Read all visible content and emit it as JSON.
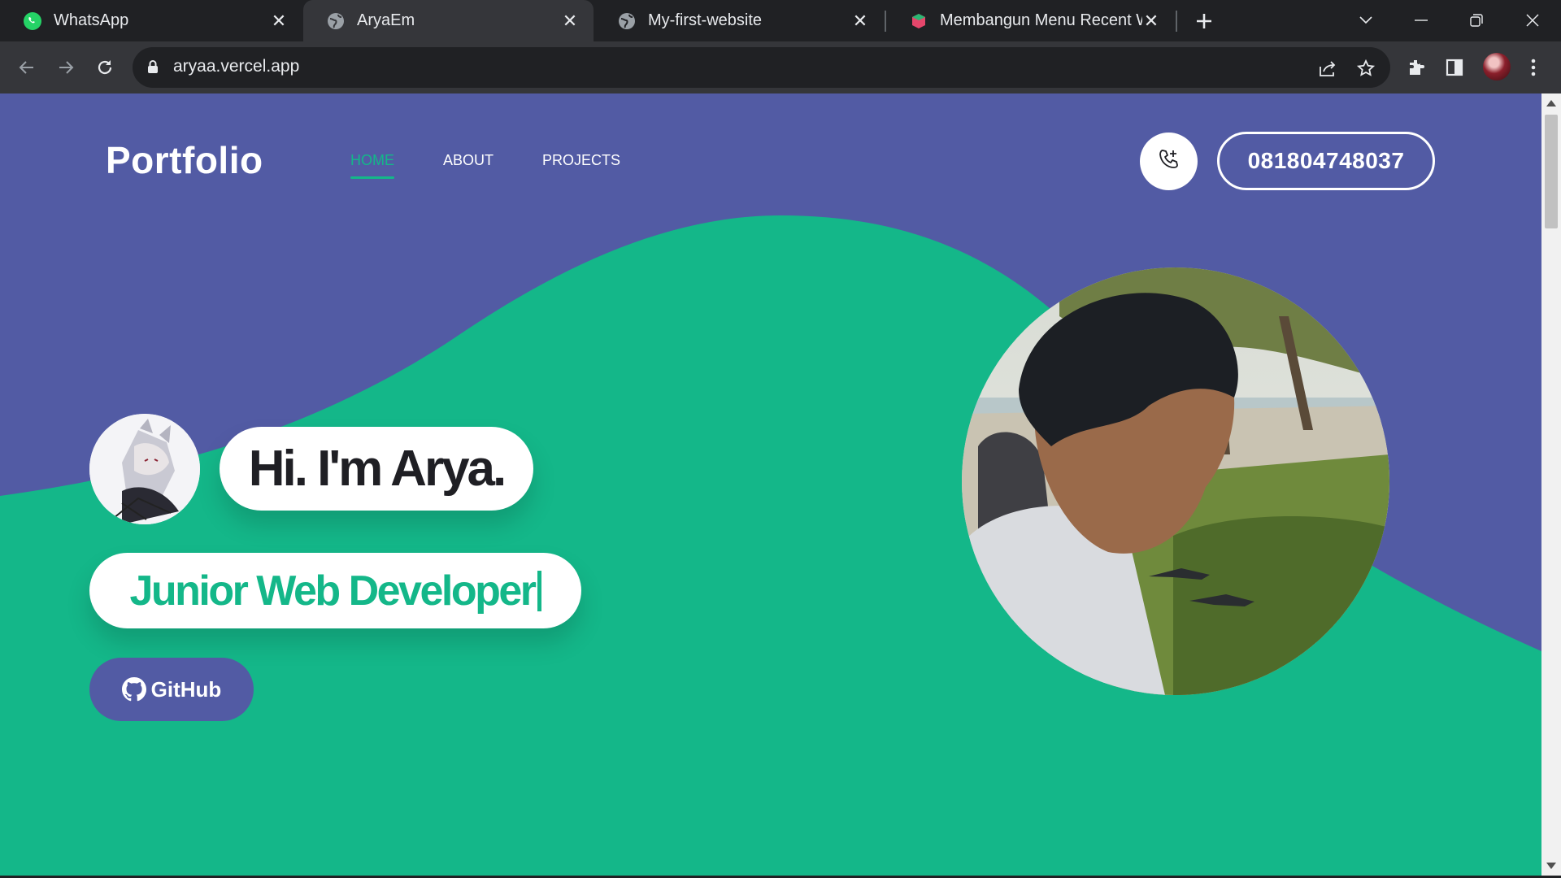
{
  "browser": {
    "tabs": [
      {
        "title": "WhatsApp",
        "icon": "whatsapp-icon",
        "active": false
      },
      {
        "title": "AryaEm",
        "icon": "globe-icon",
        "active": true
      },
      {
        "title": "My-first-website",
        "icon": "globe-icon",
        "active": false
      },
      {
        "title": "Membangun Menu Recent Work",
        "icon": "site-favicon-icon",
        "active": false
      }
    ],
    "url": "aryaa.vercel.app"
  },
  "site": {
    "logo": "Portfolio",
    "nav": [
      {
        "label": "HOME",
        "active": true
      },
      {
        "label": "ABOUT",
        "active": false
      },
      {
        "label": "PROJECTS",
        "active": false
      }
    ],
    "phone": "081804748037",
    "greeting": "Hi. I'm Arya.",
    "role": "Junior Web Developer",
    "github_label": "GitHub"
  },
  "colors": {
    "primary_purple": "#525ba4",
    "accent_green": "#14b789",
    "chrome_dark": "#202124",
    "chrome_toolbar": "#35363a"
  }
}
